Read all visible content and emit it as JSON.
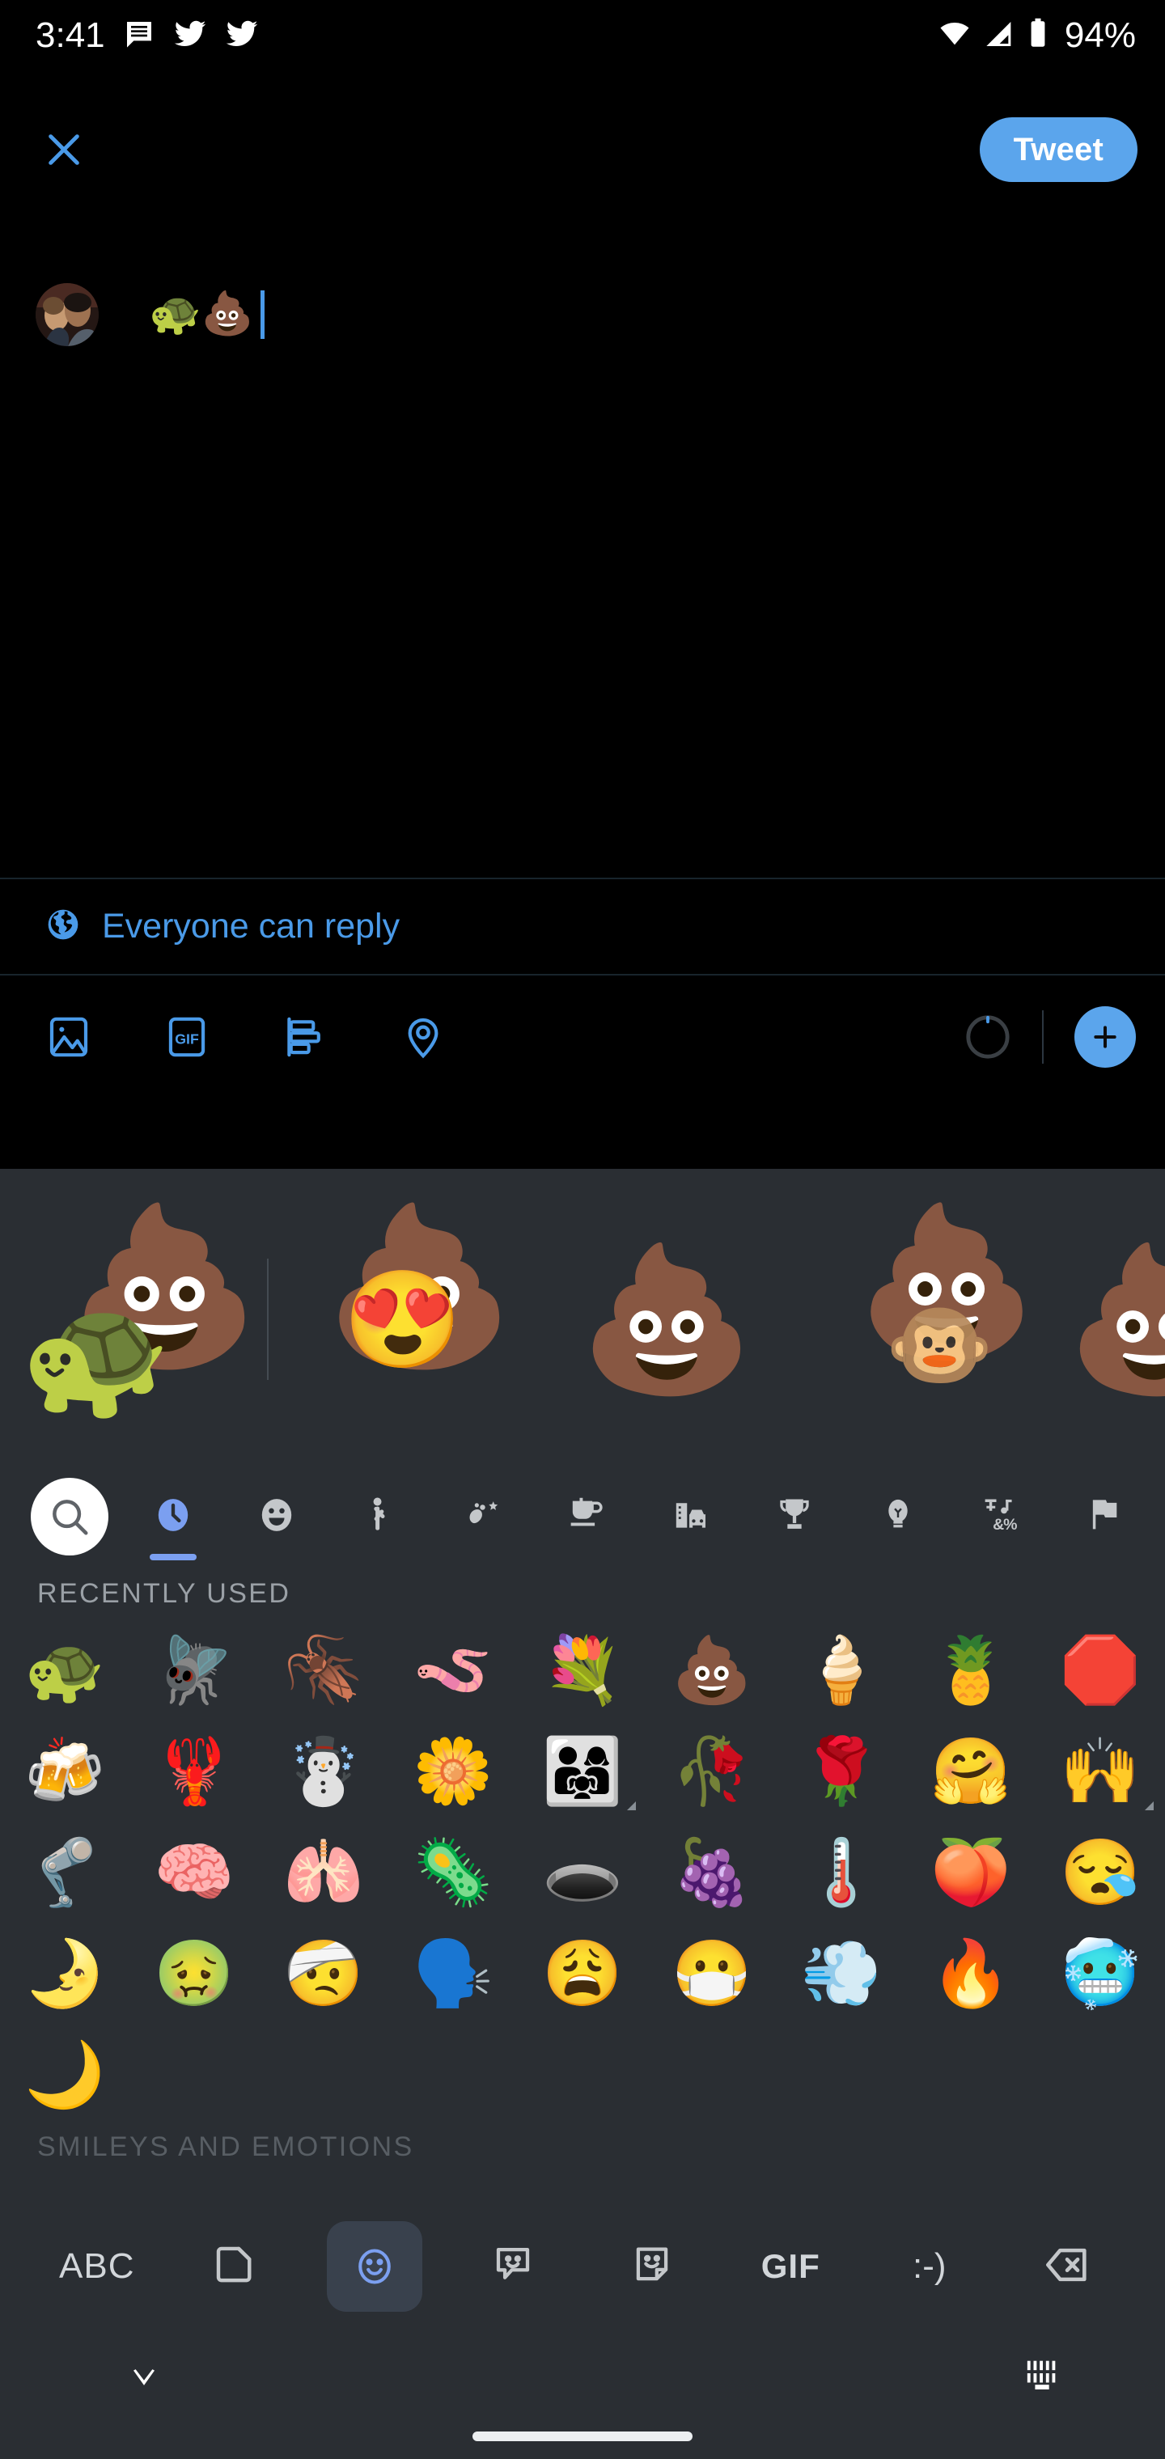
{
  "status_bar": {
    "time": "3:41",
    "battery_percent": "94%",
    "icons": [
      "message-icon",
      "twitter-bird-icon",
      "twitter-bird-icon",
      "wifi-icon",
      "cellular-signal-icon",
      "battery-icon"
    ]
  },
  "compose": {
    "close_label": "✕",
    "tweet_button_label": "Tweet",
    "text_value": "🐢💩",
    "avatar_name": "user-avatar"
  },
  "reply_settings": {
    "icon": "globe-icon",
    "label": "Everyone can reply"
  },
  "action_bar": {
    "items": [
      {
        "name": "media-image-button",
        "icon": "image-icon"
      },
      {
        "name": "gif-button",
        "icon": "gif-icon",
        "label": "GIF"
      },
      {
        "name": "poll-button",
        "icon": "poll-icon"
      },
      {
        "name": "location-button",
        "icon": "location-pin-icon"
      }
    ],
    "char_counter": "char-count-ring",
    "add_tweet_label": "+"
  },
  "keyboard": {
    "emoji_kitchen": [
      {
        "name": "sticker-turtle-poop",
        "emojis": [
          "🐢",
          "💩"
        ]
      },
      {
        "name": "sticker-poop-hearts",
        "emojis": [
          "😍",
          "💩"
        ]
      },
      {
        "name": "sticker-poop-plain",
        "emojis": [
          "💩"
        ]
      },
      {
        "name": "sticker-poop-monkey",
        "emojis": [
          "🐵",
          "💩"
        ]
      },
      {
        "name": "sticker-poop-partial",
        "emojis": [
          "💩"
        ]
      }
    ],
    "categories": [
      {
        "name": "search",
        "icon": "search-icon",
        "active": false
      },
      {
        "name": "recent",
        "icon": "clock-icon",
        "active": true
      },
      {
        "name": "smileys",
        "icon": "smiley-icon",
        "active": false
      },
      {
        "name": "people",
        "icon": "person-icon",
        "active": false
      },
      {
        "name": "animals-nature",
        "icon": "leaf-paw-icon",
        "active": false
      },
      {
        "name": "food-drink",
        "icon": "cup-icon",
        "active": false
      },
      {
        "name": "travel-places",
        "icon": "building-car-icon",
        "active": false
      },
      {
        "name": "activities",
        "icon": "trophy-icon",
        "active": false
      },
      {
        "name": "objects",
        "icon": "lightbulb-icon",
        "active": false
      },
      {
        "name": "symbols",
        "icon": "symbols-icon",
        "active": false
      },
      {
        "name": "flags",
        "icon": "flag-icon",
        "active": false
      }
    ],
    "section_recent_title": "RECENTLY USED",
    "section_next_title": "SMILEYS AND EMOTIONS",
    "recent_emojis": [
      {
        "char": "🐢",
        "name": "turtle",
        "variants": false
      },
      {
        "char": "🪰",
        "name": "fly",
        "variants": false
      },
      {
        "char": "🪳",
        "name": "cockroach",
        "variants": false
      },
      {
        "char": "🪱",
        "name": "worm",
        "variants": false
      },
      {
        "char": "💐",
        "name": "bouquet",
        "variants": false
      },
      {
        "char": "💩",
        "name": "poop",
        "variants": false
      },
      {
        "char": "🍦",
        "name": "soft-ice-cream",
        "variants": false
      },
      {
        "char": "🍍",
        "name": "pineapple",
        "variants": false
      },
      {
        "char": "🛑",
        "name": "stop-sign",
        "variants": false
      },
      {
        "char": "🍻",
        "name": "clinking-beer-mugs",
        "variants": false
      },
      {
        "char": "🦞",
        "name": "lobster",
        "variants": false
      },
      {
        "char": "☃️",
        "name": "snowman",
        "variants": false
      },
      {
        "char": "🌼",
        "name": "blossom",
        "variants": false
      },
      {
        "char": "👨‍👩‍👧",
        "name": "family",
        "variants": true
      },
      {
        "char": "🥀",
        "name": "wilted-flower",
        "variants": false
      },
      {
        "char": "🌹",
        "name": "rose",
        "variants": false
      },
      {
        "char": "🤗",
        "name": "hugging-face",
        "variants": false
      },
      {
        "char": "🙌",
        "name": "raising-hands",
        "variants": true
      },
      {
        "char": "🦿",
        "name": "mechanical-leg",
        "variants": false
      },
      {
        "char": "🧠",
        "name": "brain",
        "variants": false
      },
      {
        "char": "🫁",
        "name": "lungs",
        "variants": false
      },
      {
        "char": "🦠",
        "name": "microbe",
        "variants": false
      },
      {
        "char": "🕳️",
        "name": "hole",
        "variants": false
      },
      {
        "char": "🍇",
        "name": "grapes",
        "variants": false
      },
      {
        "char": "🌡️",
        "name": "thermometer",
        "variants": false
      },
      {
        "char": "🍑",
        "name": "peach",
        "variants": false
      },
      {
        "char": "😪",
        "name": "sleepy-face",
        "variants": false
      },
      {
        "char": "🌛",
        "name": "first-quarter-moon-face",
        "variants": false
      },
      {
        "char": "🤢",
        "name": "nauseated-face",
        "variants": false
      },
      {
        "char": "🤕",
        "name": "face-with-head-bandage",
        "variants": false
      },
      {
        "char": "🗣️",
        "name": "speaking-head",
        "variants": false
      },
      {
        "char": "😩",
        "name": "weary-face",
        "variants": false
      },
      {
        "char": "😷",
        "name": "face-with-medical-mask",
        "variants": false
      },
      {
        "char": "💨",
        "name": "dashing-away",
        "variants": false
      },
      {
        "char": "🔥",
        "name": "fire",
        "variants": false
      },
      {
        "char": "🥶",
        "name": "cold-face",
        "variants": false
      },
      {
        "char": "🌙",
        "name": "crescent-moon",
        "variants": false
      }
    ],
    "bottom_bar": [
      {
        "name": "abc-key",
        "label": "ABC",
        "type": "text",
        "active": false
      },
      {
        "name": "emoji-kitchen-key",
        "label": "",
        "type": "kitchen-icon",
        "active": false
      },
      {
        "name": "emoji-key",
        "label": "",
        "type": "smiley-icon",
        "active": true
      },
      {
        "name": "sticker-key",
        "label": "",
        "type": "sticker-speech-icon",
        "active": false
      },
      {
        "name": "avatar-sticker-key",
        "label": "",
        "type": "sticker-note-icon",
        "active": false
      },
      {
        "name": "gif-key",
        "label": "GIF",
        "type": "text-bold",
        "active": false
      },
      {
        "name": "emoticon-key",
        "label": ":-)",
        "type": "text",
        "active": false
      },
      {
        "name": "backspace-key",
        "label": "",
        "type": "backspace-icon",
        "active": false
      }
    ]
  },
  "nav_bar": {
    "down_icon": "chevron-down-icon",
    "keyboard_icon": "keyboard-icon",
    "home_indicator": "home-indicator"
  },
  "colors": {
    "accent_blue": "#5ba5ec",
    "link_blue": "#4a9ae8",
    "kb_bg": "#2a2e33",
    "app_bg": "#000000",
    "tab_active": "#7b9ff0"
  }
}
